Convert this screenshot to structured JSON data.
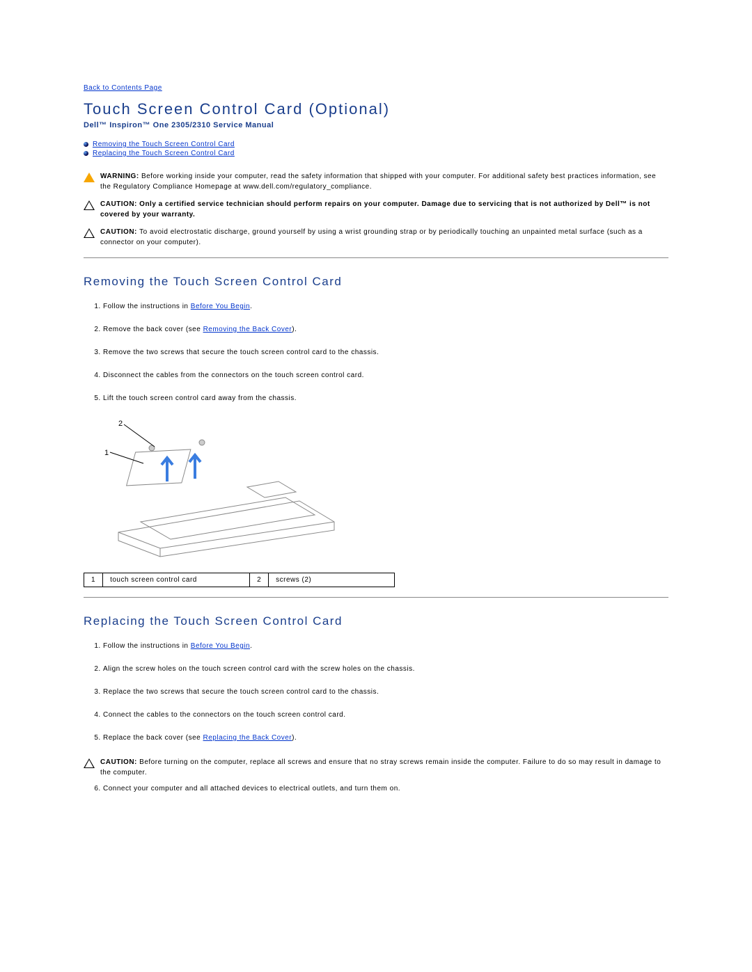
{
  "nav": {
    "back": "Back to Contents Page"
  },
  "header": {
    "title": "Touch Screen Control Card (Optional)",
    "subtitle": "Dell™ Inspiron™ One 2305/2310 Service Manual"
  },
  "toc": {
    "item1": "Removing the Touch Screen Control Card",
    "item2": "Replacing the Touch Screen Control Card"
  },
  "warnings": {
    "w1_label": "WARNING: ",
    "w1_text": "Before working inside your computer, read the safety information that shipped with your computer. For additional safety best practices information, see the Regulatory Compliance Homepage at www.dell.com/regulatory_compliance.",
    "c1_label": "CAUTION: ",
    "c1_text": "Only a certified service technician should perform repairs on your computer. Damage due to servicing that is not authorized by Dell™ is not covered by your warranty.",
    "c2_label": "CAUTION: ",
    "c2_text": "To avoid electrostatic discharge, ground yourself by using a wrist grounding strap or by periodically touching an unpainted metal surface (such as a connector on your computer)."
  },
  "removing": {
    "heading": "Removing the Touch Screen Control Card",
    "s1_pre": "Follow the instructions in ",
    "s1_link": "Before You Begin",
    "s1_post": ".",
    "s2_pre": "Remove the back cover (see ",
    "s2_link": "Removing the Back Cover",
    "s2_post": ").",
    "s3": "Remove the two screws that secure the touch screen control card to the chassis.",
    "s4": "Disconnect the cables from the connectors on the touch screen control card.",
    "s5": "Lift the touch screen control card away from the chassis."
  },
  "legend": {
    "n1": "1",
    "t1": "touch screen control card",
    "n2": "2",
    "t2": "screws (2)"
  },
  "replacing": {
    "heading": "Replacing the Touch Screen Control Card",
    "s1_pre": "Follow the instructions in ",
    "s1_link": "Before You Begin",
    "s1_post": ".",
    "s2": "Align the screw holes on the touch screen control card with the screw holes on the chassis.",
    "s3": "Replace the two screws that secure the touch screen control card to the chassis.",
    "s4": "Connect the cables to the connectors on the touch screen control card.",
    "s5_pre": "Replace the back cover (see ",
    "s5_link": "Replacing the Back Cover",
    "s5_post": ").",
    "c_label": "CAUTION: ",
    "c_text": "Before turning on the computer, replace all screws and ensure that no stray screws remain inside the computer. Failure to do so may result in damage to the computer.",
    "s6": "Connect your computer and all attached devices to electrical outlets, and turn them on."
  }
}
